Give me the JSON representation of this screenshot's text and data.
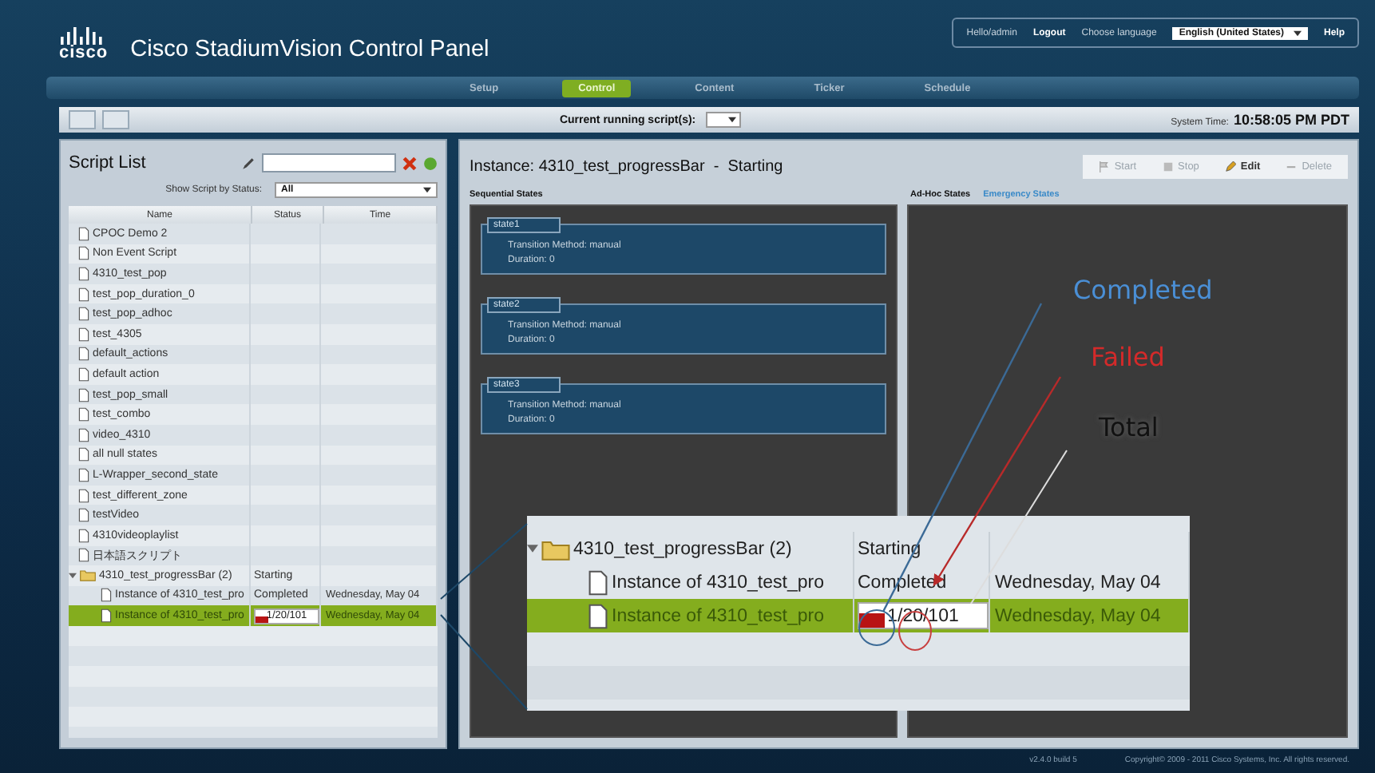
{
  "header": {
    "logo": "cisco",
    "title": "Cisco StadiumVision Control Panel",
    "greeting": "Hello/admin",
    "logout": "Logout",
    "language_label": "Choose language",
    "language": "English (United States)",
    "help": "Help"
  },
  "nav": [
    {
      "label": "Setup",
      "selected": false
    },
    {
      "label": "Control",
      "selected": true
    },
    {
      "label": "Content",
      "selected": false
    },
    {
      "label": "Ticker",
      "selected": false
    },
    {
      "label": "Schedule",
      "selected": false
    }
  ],
  "toolbar": {
    "running_label": "Current running script(s):",
    "time_label": "System Time:",
    "time": "10:58:05 PM PDT"
  },
  "script_list": {
    "title": "Script List",
    "filter_label": "Show Script by Status:",
    "filter": "All",
    "columns": [
      "Name",
      "Status",
      "Time"
    ],
    "rows": [
      {
        "kind": "script",
        "name": "CPOC Demo 2",
        "selected": false
      },
      {
        "kind": "script",
        "name": "Non Event Script",
        "selected": false
      },
      {
        "kind": "script",
        "name": "4310_test_pop",
        "selected": false
      },
      {
        "kind": "script",
        "name": "test_pop_duration_0",
        "selected": false
      },
      {
        "kind": "script",
        "name": "test_pop_adhoc",
        "selected": false
      },
      {
        "kind": "script",
        "name": "test_4305",
        "selected": false
      },
      {
        "kind": "script",
        "name": "default_actions",
        "selected": false
      },
      {
        "kind": "script",
        "name": "default action",
        "selected": false
      },
      {
        "kind": "script",
        "name": "test_pop_small",
        "selected": false
      },
      {
        "kind": "script",
        "name": "test_combo",
        "selected": false
      },
      {
        "kind": "script",
        "name": "video_4310",
        "selected": false
      },
      {
        "kind": "script",
        "name": "all null states",
        "selected": false
      },
      {
        "kind": "script",
        "name": "L-Wrapper_second_state",
        "selected": false
      },
      {
        "kind": "script",
        "name": "test_different_zone",
        "selected": false
      },
      {
        "kind": "script",
        "name": "testVideo",
        "selected": false
      },
      {
        "kind": "script",
        "name": "4310videoplaylist",
        "selected": false
      },
      {
        "kind": "script",
        "name": "日本語スクリプト",
        "selected": false
      },
      {
        "kind": "folder",
        "name": "4310_test_progressBar (2)",
        "status": "Starting",
        "expanded": true,
        "selected": false,
        "children": [
          {
            "kind": "instance",
            "name": "Instance of 4310_test_pro",
            "status": "Completed",
            "time": "Wednesday, May 04",
            "selected": false
          },
          {
            "kind": "progress",
            "name": "Instance of 4310_test_pro",
            "progress": "1/20/101",
            "level": 0.2,
            "time": "Wednesday, May 04",
            "selected": true
          }
        ]
      }
    ]
  },
  "instance": {
    "title": "Instance: 4310_test_progressBar  -  Starting",
    "buttons": [
      {
        "label": "Start",
        "kind": "start",
        "disabled": true
      },
      {
        "label": "Stop",
        "kind": "stop",
        "disabled": true
      },
      {
        "label": "Edit",
        "kind": "edit",
        "disabled": false
      },
      {
        "label": "Delete",
        "kind": "delete",
        "disabled": true
      }
    ],
    "sequential_label": "Sequential States",
    "tabs": [
      {
        "label": "Ad-Hoc States",
        "selected": true
      },
      {
        "label": "Emergency States",
        "selected": false
      }
    ],
    "states": [
      {
        "name": "state1",
        "transition": "Transition Method: manual",
        "duration": "Duration: 0"
      },
      {
        "name": "state2",
        "transition": "Transition Method: manual",
        "duration": "Duration: 0"
      },
      {
        "name": "state3",
        "transition": "Transition Method: manual",
        "duration": "Duration: 0"
      }
    ]
  },
  "magnifier": {
    "rows": [
      {
        "kind": "folder",
        "name": "4310_test_progressBar (2)",
        "status": "Starting",
        "expanded": true,
        "selected": false,
        "children": [
          {
            "kind": "instance",
            "name": "Instance of 4310_test_pro",
            "status": "Completed",
            "time": "Wednesday, May 04",
            "selected": false
          },
          {
            "kind": "progress",
            "name": "Instance of 4310_test_pro",
            "progress": "1/20/101",
            "level": 0.2,
            "time": "Wednesday, May 04",
            "selected": true
          }
        ]
      }
    ]
  },
  "annotations": [
    {
      "text": "Completed",
      "color": "#4a8fd6"
    },
    {
      "text": "Failed",
      "color": "#d42a2a"
    },
    {
      "text": "Total",
      "color": "#111111"
    }
  ],
  "footer": {
    "version": "v2.4.0 build 5",
    "copyright": "Copyright© 2009 - 2011 Cisco Systems, Inc. All rights reserved."
  }
}
